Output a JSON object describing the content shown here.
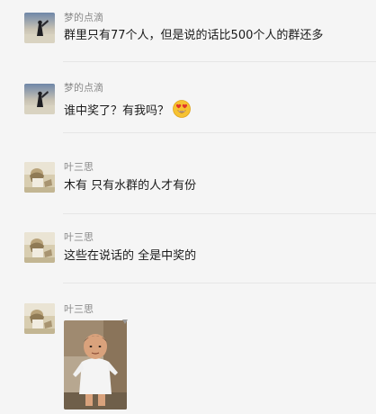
{
  "messages": [
    {
      "sender": "梦的点滴",
      "text": "群里只有77个人，但是说的话比500个人的群还多",
      "avatar": "avatar-fan-silhouette"
    },
    {
      "sender": "梦的点滴",
      "text": "谁中奖了？有我吗？",
      "emoji": "heart-eyes-emoji",
      "avatar": "avatar-fan-silhouette"
    },
    {
      "sender": "叶三思",
      "text": "木有  只有水群的人才有份",
      "avatar": "avatar-sepia-portrait"
    },
    {
      "sender": "叶三思",
      "text": "这些在说话的  全是中奖的",
      "avatar": "avatar-sepia-portrait"
    },
    {
      "sender": "叶三思",
      "image": "toddler-photo",
      "avatar": "avatar-sepia-portrait"
    }
  ],
  "colors": {
    "background": "#f5f5f5",
    "sender_name": "#8a8a8a",
    "message_text": "#1a1a1a",
    "divider": "#e6e6e6"
  }
}
